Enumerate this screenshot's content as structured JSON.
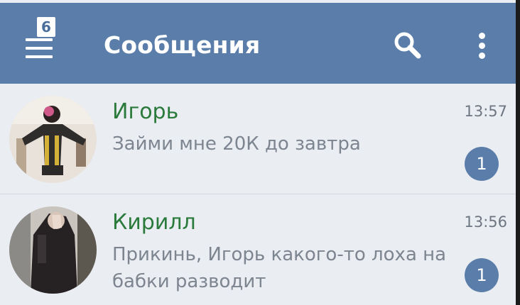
{
  "header": {
    "title": "Сообщения",
    "menu_badge": "6",
    "bar_color": "#5a7daa",
    "icons": [
      "hamburger-menu-icon",
      "search-icon",
      "more-vertical-icon"
    ]
  },
  "dialogs": [
    {
      "name": "Игорь",
      "message": "Займи мне 20К до завтра",
      "time": "13:57",
      "unread": "1"
    },
    {
      "name": "Кирилл",
      "message": "Прикинь, Игорь какого-то лоха на бабки разводит",
      "time": "13:56",
      "unread": "1"
    }
  ],
  "colors": {
    "name": "#2a7a3c",
    "message": "#7d8590",
    "background": "#eaedf2",
    "badge": "#5a7daa"
  }
}
